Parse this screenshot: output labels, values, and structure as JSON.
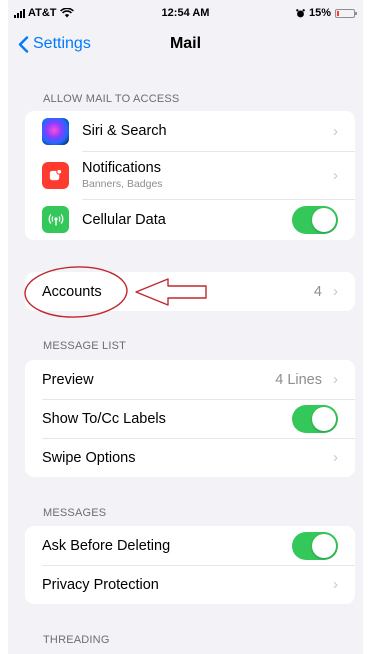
{
  "status_bar": {
    "carrier": "AT&T",
    "time": "12:54 AM",
    "battery": "15%",
    "battery_fraction": 0.15
  },
  "nav": {
    "back_label": "Settings",
    "title": "Mail"
  },
  "allow_access": {
    "header": "ALLOW MAIL TO ACCESS",
    "items": [
      {
        "label": "Siri & Search",
        "icon": "siri-icon"
      },
      {
        "label": "Notifications",
        "sublabel": "Banners, Badges",
        "icon": "notifications-icon"
      },
      {
        "label": "Cellular Data",
        "icon": "cellular-icon",
        "toggle": true
      }
    ]
  },
  "accounts": {
    "label": "Accounts",
    "value": "4"
  },
  "message_list": {
    "header": "MESSAGE LIST",
    "items": [
      {
        "label": "Preview",
        "value": "4 Lines"
      },
      {
        "label": "Show To/Cc Labels",
        "toggle": true
      },
      {
        "label": "Swipe Options"
      }
    ]
  },
  "messages": {
    "header": "MESSAGES",
    "items": [
      {
        "label": "Ask Before Deleting",
        "toggle": true
      },
      {
        "label": "Privacy Protection"
      }
    ]
  },
  "threading": {
    "header": "THREADING"
  },
  "colors": {
    "accent": "#007aff",
    "toggle_on": "#34c759",
    "annotation": "#c0282d"
  }
}
